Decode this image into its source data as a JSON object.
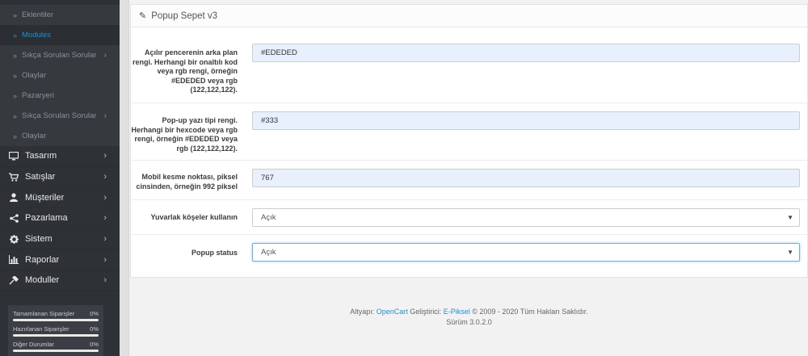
{
  "sidebar": {
    "sub_items": [
      {
        "label": "Eklentiler",
        "active": false,
        "has_arrow": false
      },
      {
        "label": "Modules",
        "active": true,
        "has_arrow": false
      },
      {
        "label": "Sıkça Sorulan Sorular",
        "active": false,
        "has_arrow": true
      },
      {
        "label": "Olaylar",
        "active": false,
        "has_arrow": false
      },
      {
        "label": "Pazaryeri",
        "active": false,
        "has_arrow": false
      },
      {
        "label": "Sıkça Sorulan Sorular",
        "active": false,
        "has_arrow": true
      },
      {
        "label": "Olaylar",
        "active": false,
        "has_arrow": false
      }
    ],
    "main_items": [
      {
        "label": "Tasarım",
        "icon": "monitor-icon"
      },
      {
        "label": "Satışlar",
        "icon": "cart-icon"
      },
      {
        "label": "Müşteriler",
        "icon": "user-icon"
      },
      {
        "label": "Pazarlama",
        "icon": "share-icon"
      },
      {
        "label": "Sistem",
        "icon": "gear-icon"
      },
      {
        "label": "Raporlar",
        "icon": "bar-chart-icon"
      },
      {
        "label": "Moduller",
        "icon": "puzzle-icon"
      }
    ],
    "stats": [
      {
        "label": "Tamamlanan Siparişler",
        "value": "0%"
      },
      {
        "label": "Hazırlanan Siparişler",
        "value": "0%"
      },
      {
        "label": "Diğer Durumlar",
        "value": "0%"
      }
    ]
  },
  "panel": {
    "title": "Popup Sepet v3",
    "fields": [
      {
        "label": "Açılır pencerenin arka plan rengi. Herhangi bir onaltılı kod veya rgb rengi, örneğin #EDEDED veya rgb (122,122,122).",
        "value": "#EDEDED",
        "type": "input"
      },
      {
        "label": "Pop-up yazı tipi rengi. Herhangi bir hexcode veya rgb rengi, örneğin #EDEDED veya rgb (122,122,122).",
        "value": "#333",
        "type": "input"
      },
      {
        "label": "Mobil kesme noktası, piksel cinsinden, örneğin 992 piksel",
        "value": "767",
        "type": "input"
      },
      {
        "label": "Yuvarlak köşeler kullanın",
        "value": "Açık",
        "type": "select"
      },
      {
        "label": "Popup status",
        "value": "Açık",
        "type": "select"
      }
    ]
  },
  "footer": {
    "prefix": "Altyapı: ",
    "opencart": "OpenCart",
    "middle": " Geliştirici: ",
    "epiksel": "E-Piksel",
    "suffix": " © 2009 - 2020 Tüm Hakları Saklıdır.",
    "version": "Sürüm 3.0.2.0"
  }
}
